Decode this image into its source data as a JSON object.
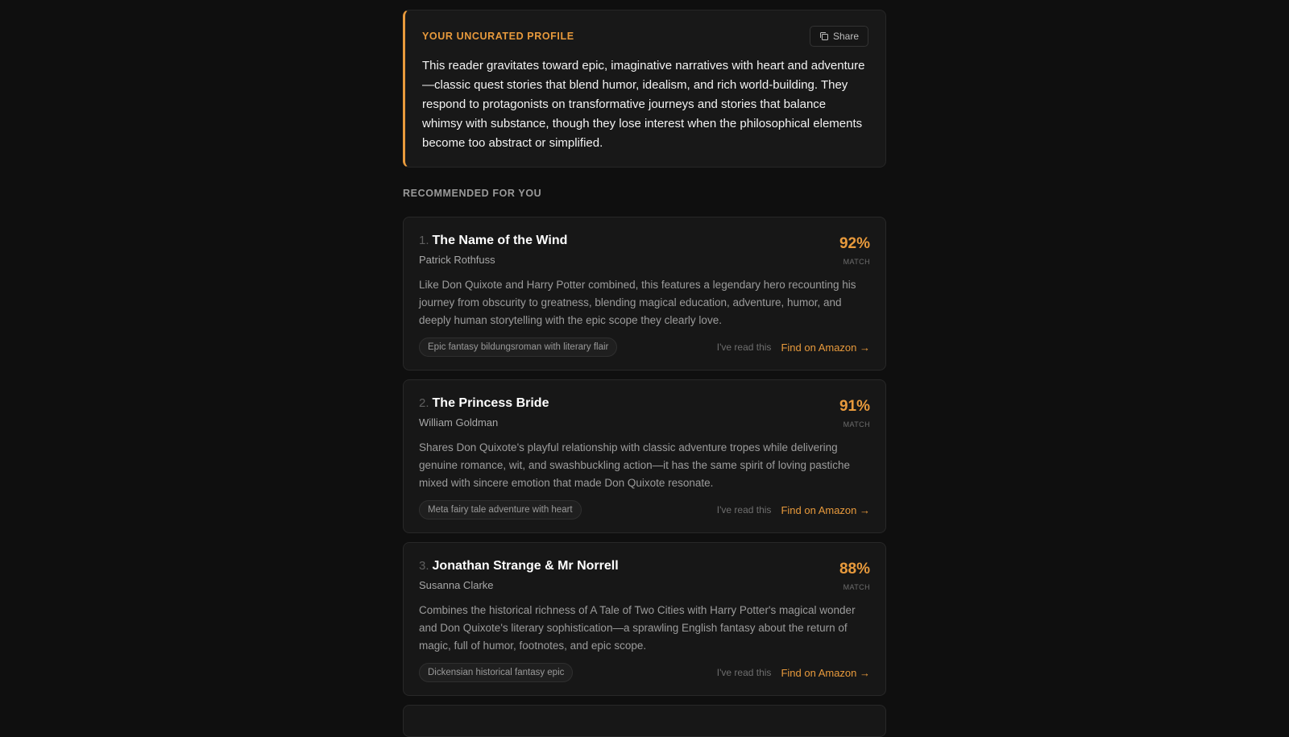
{
  "profile": {
    "title": "YOUR UNCURATED PROFILE",
    "share_label": "Share",
    "share_icon": "copy-icon",
    "text": "This reader gravitates toward epic, imaginative narratives with heart and adventure—classic quest stories that blend humor, idealism, and rich world-building. They respond to protagonists on transformative journeys and stories that balance whimsy with substance, though they lose interest when the philosophical elements become too abstract or simplified."
  },
  "recommendations": {
    "section_label": "RECOMMENDED FOR YOU",
    "items": [
      {
        "number": "1.",
        "title": "The Name of the Wind",
        "author": "Patrick Rothfuss",
        "match_pct": "92%",
        "match_label": "MATCH",
        "description": "Like Don Quixote and Harry Potter combined, this features a legendary hero recounting his journey from obscurity to greatness, blending magical education, adventure, humor, and deeply human storytelling with the epic scope they clearly love.",
        "tag": "Epic fantasy bildungsroman with literary flair",
        "read_label": "I've read this",
        "amazon_label": "Find on Amazon →"
      },
      {
        "number": "2.",
        "title": "The Princess Bride",
        "author": "William Goldman",
        "match_pct": "91%",
        "match_label": "MATCH",
        "description": "Shares Don Quixote's playful relationship with classic adventure tropes while delivering genuine romance, wit, and swashbuckling action—it has the same spirit of loving pastiche mixed with sincere emotion that made Don Quixote resonate.",
        "tag": "Meta fairy tale adventure with heart",
        "read_label": "I've read this",
        "amazon_label": "Find on Amazon →"
      },
      {
        "number": "3.",
        "title": "Jonathan Strange & Mr Norrell",
        "author": "Susanna Clarke",
        "match_pct": "88%",
        "match_label": "MATCH",
        "description": "Combines the historical richness of A Tale of Two Cities with Harry Potter's magical wonder and Don Quixote's literary sophistication—a sprawling English fantasy about the return of magic, full of humor, footnotes, and epic scope.",
        "tag": "Dickensian historical fantasy epic",
        "read_label": "I've read this",
        "amazon_label": "Find on Amazon →"
      }
    ]
  },
  "colors": {
    "accent": "#e89a3c",
    "background": "#0f0f0f",
    "card": "#171717"
  }
}
